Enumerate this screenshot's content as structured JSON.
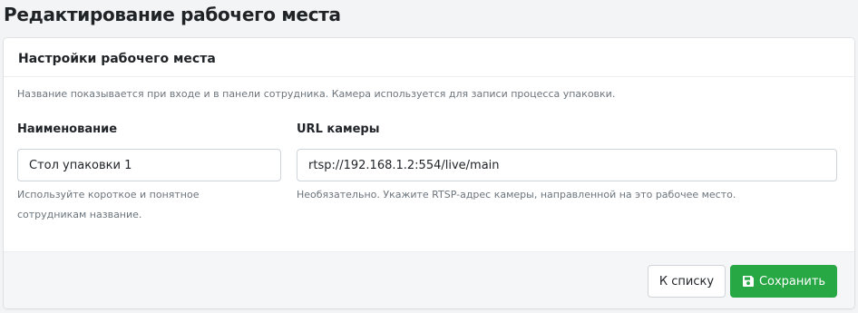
{
  "page": {
    "title": "Редактирование рабочего места"
  },
  "card": {
    "header": "Настройки рабочего места",
    "help": "Название показывается при входе и в панели сотрудника. Камера используется для записи процесса упаковки."
  },
  "form": {
    "name": {
      "label": "Наименование",
      "value": "Стол упаковки 1",
      "hint_line1": "Используйте короткое и понятное",
      "hint_line2": "сотрудникам название."
    },
    "camera": {
      "label": "URL камеры",
      "value": "rtsp://192.168.1.2:554/live/main",
      "hint": "Необязательно. Укажите RTSP-адрес камеры, направленной на это рабочее место."
    }
  },
  "footer": {
    "back_label": "К списку",
    "save_label": "Сохранить",
    "save_icon": "floppy-disk-icon"
  },
  "colors": {
    "primary_success": "#28a745",
    "background": "#f3f4f6",
    "muted_text": "#6c757d"
  }
}
